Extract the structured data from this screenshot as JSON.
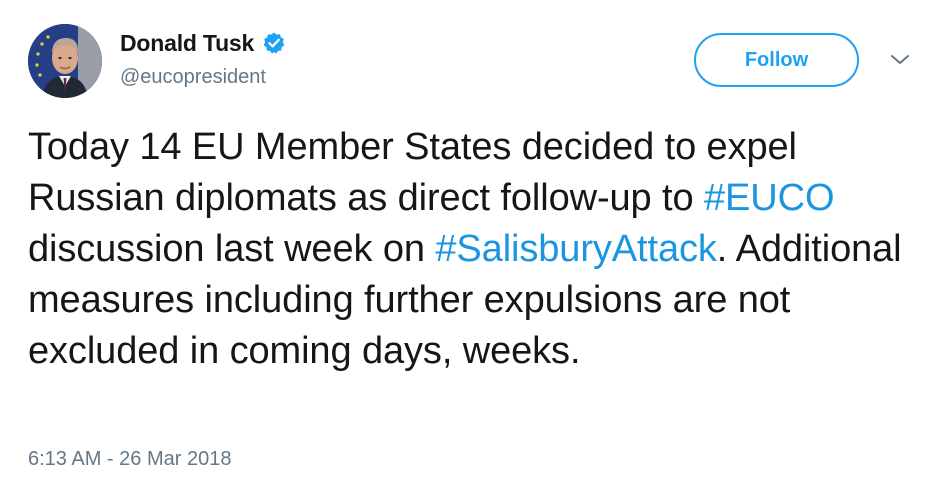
{
  "author": {
    "display_name": "Donald Tusk",
    "handle": "@eucopresident",
    "verified": true,
    "avatar_icon": "profile-photo"
  },
  "actions": {
    "follow_label": "Follow",
    "menu_icon": "chevron-down-icon"
  },
  "tweet": {
    "segment_1": "Today 14 EU Member States decided to expel Russian diplomats as direct follow-up to ",
    "hashtag_1": "#EUCO",
    "segment_2": " discussion last week on ",
    "hashtag_2": "#SalisburyAttack",
    "segment_3": ". Additional measures including further expulsions are not excluded in coming days, weeks."
  },
  "timestamp": "6:13 AM - 26 Mar 2018",
  "colors": {
    "link": "#1b95e0",
    "follow_accent": "#1da1f2",
    "secondary_text": "#657786",
    "primary_text": "#14171a"
  }
}
